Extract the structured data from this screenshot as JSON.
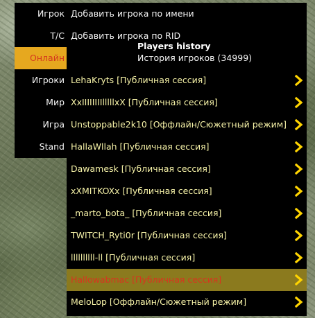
{
  "sidebar": {
    "items": [
      {
        "label": "Игрок"
      },
      {
        "label": "T/C"
      },
      {
        "label": "Онлайн",
        "active": true
      },
      {
        "label": "Игроки"
      },
      {
        "label": "Мир"
      },
      {
        "label": "Игра"
      },
      {
        "label": "Stand"
      }
    ]
  },
  "menu": {
    "top_actions": [
      {
        "label": "Добавить игрока по имени"
      },
      {
        "label": "Добавить игрока по RID"
      }
    ],
    "header": {
      "title": "Players history",
      "subtitle": "История игроков (34999)"
    },
    "players": [
      {
        "label": "LehaKryts [Публичная сессия]"
      },
      {
        "label": "XxIIIIIIIIlllllxX [Публичная сессия]"
      },
      {
        "label": "Unstoppable2k10 [Оффлайн/Сюжетный режим]"
      },
      {
        "label": "HallaWllah [Публичная сессия]"
      },
      {
        "label": "Dawamesk [Публичная сессия]"
      },
      {
        "label": "xXMITKOXx [Публичная сессия]"
      },
      {
        "label": "_marto_bota_ [Публичная сессия]"
      },
      {
        "label": "TWITCH_Ryti0r [Публичная сессия]"
      },
      {
        "label": "llllllllll-ll [Публичная сессия]"
      },
      {
        "label": "Hallowabmac [Публичная сессия]",
        "highlighted": true
      },
      {
        "label": "MeloLop [Оффлайн/Сюжетный режим]"
      }
    ]
  },
  "colors": {
    "panel_bg": "#000000",
    "row_text": "#f7f3a8",
    "side_text": "#f5f5f5",
    "active_tab_bg": "#e6a81f",
    "active_tab_text": "#d5361e",
    "highlight_row_bg": "#8b7a1e",
    "highlight_row_text": "#d8341e",
    "chevron": "#ffd400"
  },
  "icons": {
    "row_arrow": "chevron-right-icon"
  }
}
